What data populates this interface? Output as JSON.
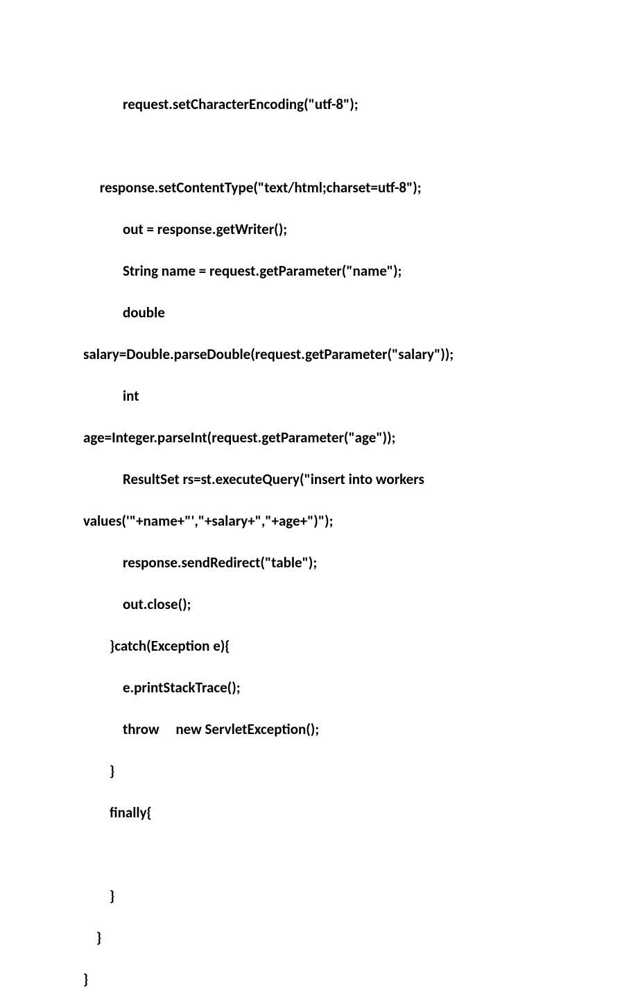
{
  "code": {
    "line1": "            request.setCharacterEncoding(\"utf-8\");",
    "line2": "        ",
    "line3": "     response.setContentType(\"text/html;charset=utf-8\");",
    "line4": "            out = response.getWriter();",
    "line5": "            String name = request.getParameter(\"name\");",
    "line6": "            double",
    "line7": "salary=Double.parseDouble(request.getParameter(\"salary\"));",
    "line8": "            int",
    "line9": "age=Integer.parseInt(request.getParameter(\"age\"));",
    "line10": "            ResultSet rs=st.executeQuery(\"insert into workers",
    "line11": "values('\"+name+\"',\"+salary+\",\"+age+\")\");",
    "line12": "            response.sendRedirect(\"table\");",
    "line13": "            out.close();",
    "line14": "        }catch(Exception e){",
    "line15": "            e.printStackTrace();",
    "line16": "            throw     new ServletException();",
    "line17": "        }",
    "line18": "        finally{",
    "line19": "            ",
    "line20": "        }",
    "line21": "    }  ",
    "line22": "}"
  }
}
